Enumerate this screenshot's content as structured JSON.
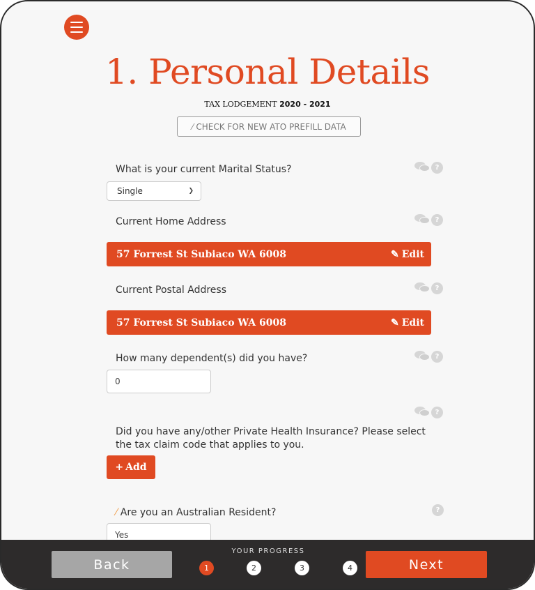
{
  "header": {
    "menu_icon": "hamburger-menu-icon",
    "title": "1. Personal Details",
    "subtitle_prefix": "TAX LODGEMENT",
    "subtitle_year": "2020 - 2021",
    "prefill_button": "CHECK FOR NEW ATO PREFILL DATA"
  },
  "form": {
    "marital_status": {
      "label": "What is your current Marital Status?",
      "value": "Single"
    },
    "home_address": {
      "label": "Current Home Address",
      "value": "57 Forrest St Subiaco WA 6008",
      "edit_label": "Edit"
    },
    "postal_address": {
      "label": "Current Postal Address",
      "value": "57 Forrest St Subiaco WA 6008",
      "edit_label": "Edit"
    },
    "dependents": {
      "label": "How many dependent(s) did you have?",
      "value": "0"
    },
    "health_insurance": {
      "label_line1": "Did you have any/other Private Health Insurance? Please select",
      "label_line2": "the tax claim code that applies to you.",
      "add_label": "Add"
    },
    "resident": {
      "label": "Are you an Australian Resident?",
      "value": "Yes"
    }
  },
  "footer": {
    "back_label": "Back",
    "next_label": "Next",
    "progress_label": "YOUR PROGRESS",
    "steps": [
      "1",
      "2",
      "3",
      "4"
    ],
    "active_step": 1
  },
  "colors": {
    "accent": "#e04a22",
    "footer_bg": "#2d2b2b",
    "back_bg": "#a6a6a6"
  }
}
